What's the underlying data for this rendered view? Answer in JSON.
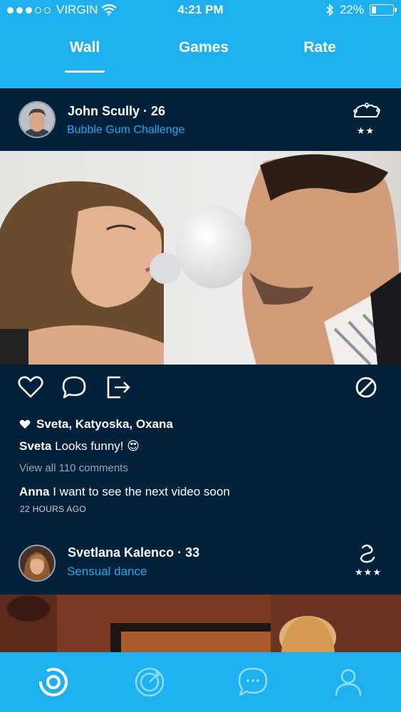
{
  "status_bar": {
    "carrier": "VIRGIN",
    "time": "4:21 PM",
    "battery": "22%",
    "battery_level": 0.22,
    "signal_dots_filled": 3,
    "signal_dots_total": 5
  },
  "tabs": [
    {
      "label": "Wall",
      "active": true
    },
    {
      "label": "Games",
      "active": false
    },
    {
      "label": "Rate",
      "active": false
    }
  ],
  "posts": [
    {
      "user": "John Scully · 26",
      "challenge": "Bubble Gum Challenge",
      "stars": "★★",
      "level_icon": "jester-hat-icon",
      "liked_by": "Sveta, Katyoska, Oxana",
      "top_comment": {
        "author": "Sveta",
        "text": "Looks funny! 😍"
      },
      "view_all": "View all 110 comments",
      "last_comment": {
        "author": "Anna",
        "text": "I want to see the next video soon"
      },
      "time_ago": "22 HOURS AGO"
    },
    {
      "user": "Svetlana Kalenco · 33",
      "challenge": "Sensual dance",
      "stars": "★★★",
      "level_icon": "snake-icon"
    }
  ],
  "actions": [
    "heart-icon",
    "comment-icon",
    "share-icon",
    "block-icon"
  ],
  "bottom_nav": [
    "home-ring-icon",
    "target-icon",
    "chat-icon",
    "profile-icon"
  ],
  "colors": {
    "accent": "#1fb1ef",
    "background": "#03213a",
    "link": "#22a8f0"
  }
}
